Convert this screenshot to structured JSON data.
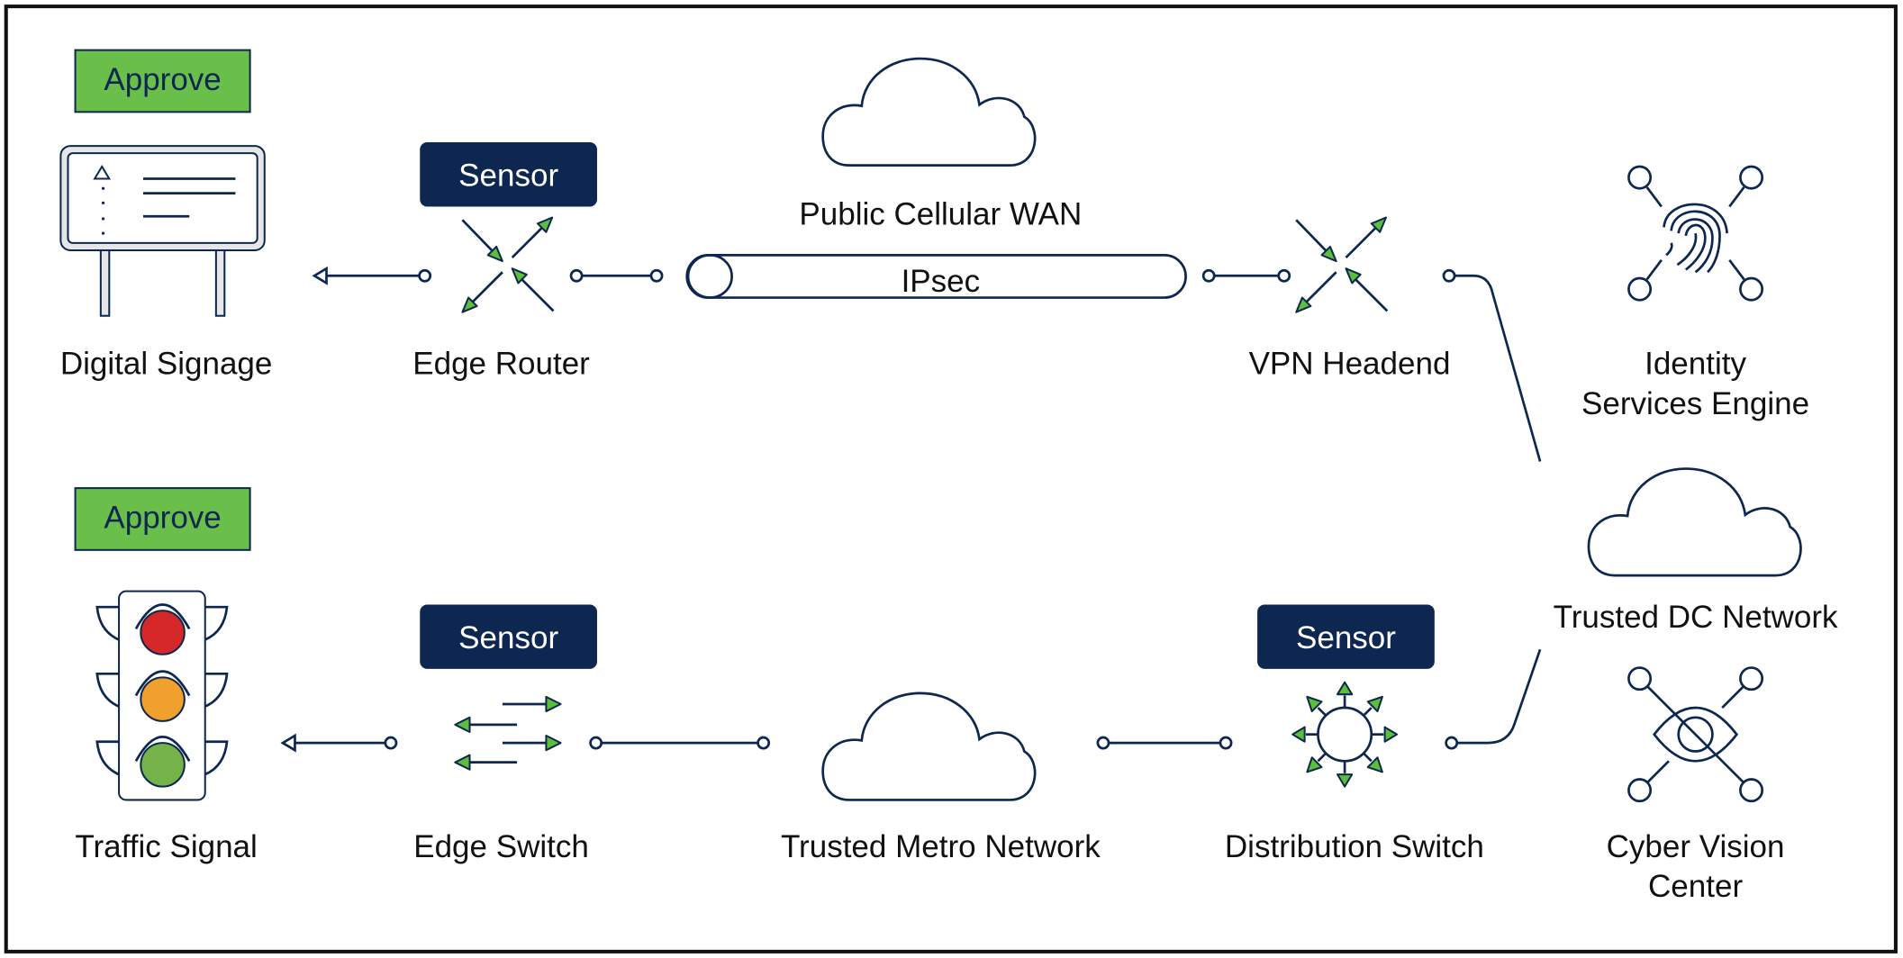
{
  "colors": {
    "navy": "#0d2750",
    "approve_green": "#6abf4b",
    "arrow_green": "#5cbf3a",
    "red_light": "#d62828",
    "amber_light": "#f0a02c",
    "green_light": "#76b24a"
  },
  "top_row": {
    "approve": "Approve",
    "digital_signage": "Digital Signage",
    "sensor": "Sensor",
    "edge_router": "Edge Router",
    "wan_label": "Public Cellular WAN",
    "tunnel": "IPsec",
    "vpn_headend": "VPN Headend",
    "ise_line1": "Identity",
    "ise_line2": "Services Engine"
  },
  "middle": {
    "dc_network": "Trusted DC Network"
  },
  "bottom_row": {
    "approve": "Approve",
    "traffic_signal": "Traffic Signal",
    "sensor_edge": "Sensor",
    "edge_switch": "Edge Switch",
    "metro_network": "Trusted Metro Network",
    "sensor_dist": "Sensor",
    "distribution_switch": "Distribution Switch",
    "cv_line1": "Cyber Vision",
    "cv_line2": "Center"
  }
}
